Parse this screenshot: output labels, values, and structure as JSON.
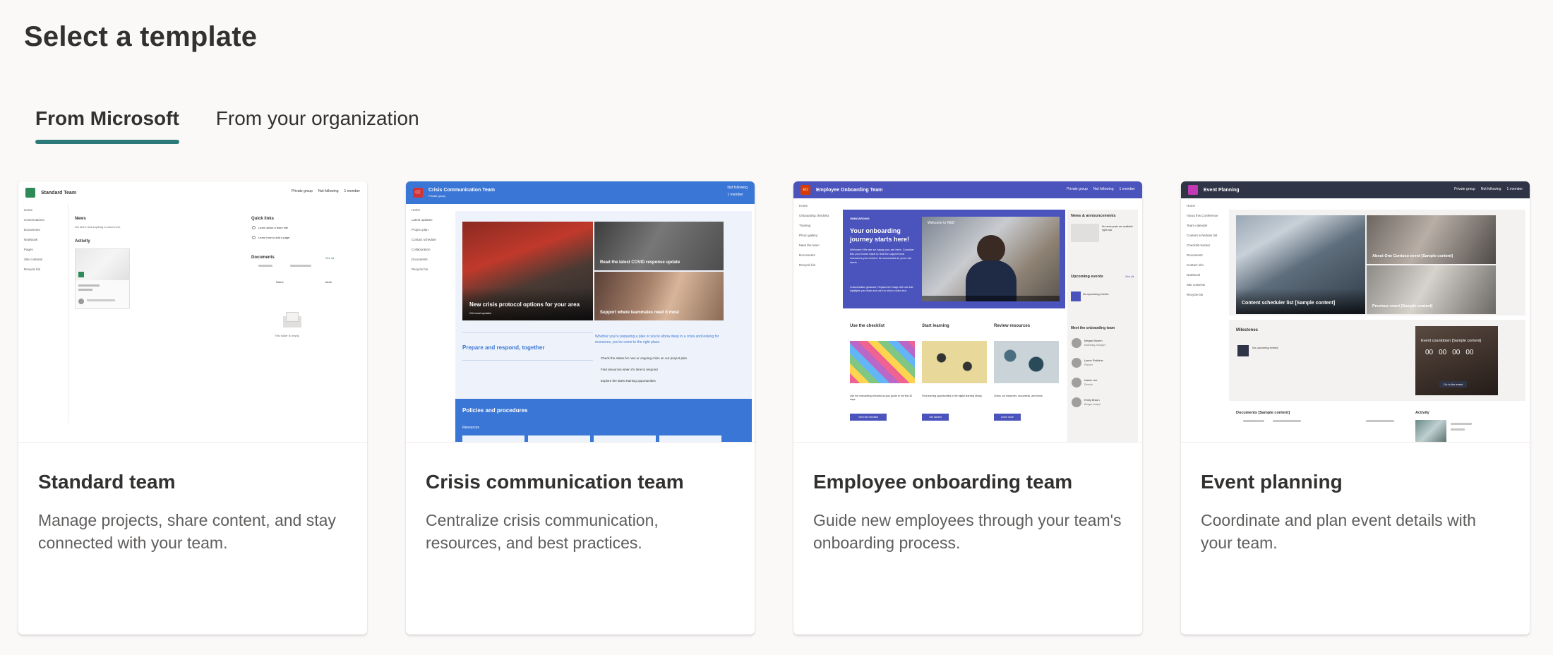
{
  "page": {
    "title": "Select a template"
  },
  "tabs": [
    {
      "label": "From Microsoft",
      "active": true
    },
    {
      "label": "From your organization",
      "active": false
    }
  ],
  "colors": {
    "accent": "#2b7a78",
    "crisis_blue": "#3a76d6",
    "onboarding_indigo": "#4b53bc",
    "event_dark": "#2f3447"
  },
  "templates": [
    {
      "title": "Standard team",
      "description": "Manage projects, share content, and stay connected with your team.",
      "preview": {
        "site_name": "Standard Team",
        "header_right": [
          "Private group",
          "Not following",
          "1 member"
        ],
        "nav": [
          "Home",
          "Conversations",
          "Documents",
          "Notebook",
          "Pages",
          "Site contents",
          "Recycle bin"
        ],
        "news": "News",
        "news_text": "We didn't find anything to show here.",
        "activity": "Activity",
        "quick_links": "Quick links",
        "quick_link_items": [
          "Learn about a team site",
          "Learn how to add a page"
        ],
        "documents": "Documents",
        "see_all": "See all",
        "doc_columns": [
          "Name",
          "Modi"
        ],
        "empty_text": "This folder is empty"
      }
    },
    {
      "title": "Crisis communication team",
      "description": "Centralize crisis communication, resources, and best practices.",
      "preview": {
        "site_name": "Crisis Communication Team",
        "site_sub": "Private group",
        "logo_text": "CC",
        "header_right": [
          "Not following",
          "1 member"
        ],
        "nav": [
          "Home",
          "Latest updates",
          "Project plan",
          "Contact schedule",
          "Collaboration",
          "Documents",
          "Recycle bin"
        ],
        "hero_main": "New crisis protocol options for your area",
        "hero_main_sub": "Get local updates",
        "hero_top": "Read the latest COVID response update",
        "hero_bottom": "Support where teammates need it most",
        "prepare": "Prepare and respond, together",
        "intro": "Whether you're preparing a plan or you're elbow deep in a crisis and looking for resources, you've come to the right place.",
        "bullets": [
          "Check the status for new or ongoing crisis on our project plan",
          "Find resources when it's time to respond",
          "Explore the latest training opportunities"
        ],
        "policies": "Policies and procedures",
        "resources": "Resources"
      }
    },
    {
      "title": "Employee onboarding team",
      "description": "Guide new employees through your team's onboarding process.",
      "preview": {
        "site_name": "Employee Onboarding Team",
        "logo_text": "EO",
        "header_right": [
          "Private group",
          "Not following",
          "1 member"
        ],
        "nav": [
          "Home",
          "Onboarding checklist",
          "Training",
          "Photo gallery",
          "Meet the team",
          "Documents",
          "Recycle bin"
        ],
        "hero_tag": "ONBOARDING",
        "hero_title": "Your onboarding journey starts here!",
        "hero_text": "Welcome! We are so happy you are here. Consider this your home base to find the support and resources you need to be successful as your role starts.",
        "hero_footer": "Customization guidance: Replace the image with one that highlights your team and use it to show a video tour.",
        "video_title": "Welcome to R&D",
        "news": "News & announcements",
        "news_text": "No news posts are available right now",
        "events": "Upcoming events",
        "events_item": "No upcoming events",
        "see_all": "See all",
        "columns": [
          {
            "title": "Use the checklist",
            "text": "Use the onboarding checklist as your guide to the first 30 days.",
            "button": "View the checklist"
          },
          {
            "title": "Start learning",
            "text": "Find learning opportunities in the digital learning library.",
            "button": "Get started"
          },
          {
            "title": "Review resources",
            "text": "Check out resources, documents, and forms.",
            "button": "Learn more"
          }
        ],
        "team_heading": "Meet the onboarding team",
        "team": [
          {
            "name": "Megan Bowen",
            "role": "Marketing manager"
          },
          {
            "name": "Lynne Robbins",
            "role": "Planner"
          },
          {
            "name": "Isaiah Lee",
            "role": "Director"
          },
          {
            "name": "Emily Braun",
            "role": "Budget analyst"
          }
        ]
      }
    },
    {
      "title": "Event planning",
      "description": "Coordinate and plan event details with your team.",
      "preview": {
        "site_name": "Event Planning",
        "header_right": [
          "Private group",
          "Not following",
          "1 member"
        ],
        "nav": [
          "Home",
          "About this Conference",
          "Team calendar",
          "Content scheduler list",
          "Checklist tracker",
          "Documents",
          "Contact info",
          "Notebook",
          "Site contents",
          "Recycle bin"
        ],
        "hero_main": "Content scheduler list [Sample content]",
        "hero_top": "About One Contoso event [Sample content]",
        "hero_bottom": "Previous event [Sample content]",
        "milestones": "Milestones",
        "milestones_item": "No upcoming events",
        "countdown": "Event countdown [Sample content]",
        "countdown_digits": [
          "00",
          "00",
          "00",
          "00"
        ],
        "countdown_link": "Go to the event",
        "documents": "Documents [Sample content]",
        "activity": "Activity"
      }
    }
  ]
}
